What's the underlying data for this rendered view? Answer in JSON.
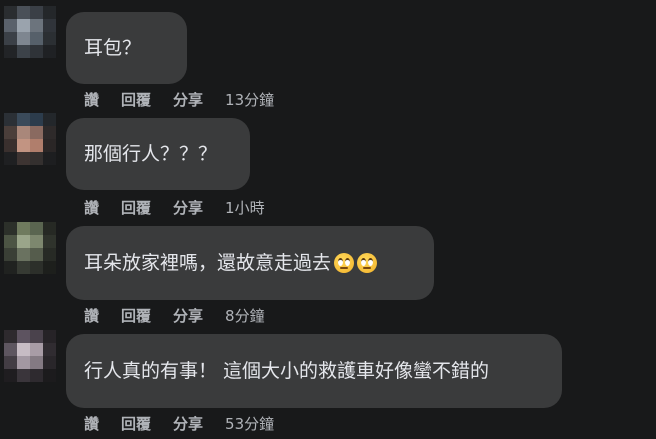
{
  "actions": {
    "like": "讚",
    "reply": "回覆",
    "share": "分享"
  },
  "comments": [
    {
      "text": "耳包？",
      "time": "13分鐘"
    },
    {
      "text": "那個行人？？？",
      "time": "1小時"
    },
    {
      "text": "耳朵放家裡嗎，還故意走過去",
      "emoji": [
        "face-with-rolling-eyes-icon",
        "face-with-rolling-eyes-icon"
      ],
      "time": "8分鐘"
    },
    {
      "text": "行人真的有事！ 這個大小的救護車好像蠻不錯的",
      "time": "53分鐘"
    }
  ]
}
